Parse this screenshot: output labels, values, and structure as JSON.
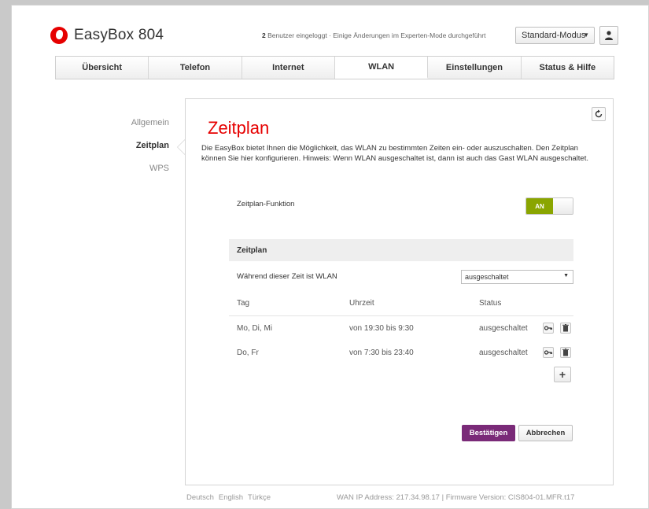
{
  "brand": {
    "name": "EasyBox 804"
  },
  "header": {
    "users_count": "2",
    "status_suffix": " Benutzer eingeloggt · Einige Änderungen im Experten-Mode durchgeführt",
    "mode": "Standard-Modus"
  },
  "nav": {
    "tabs": [
      "Übersicht",
      "Telefon",
      "Internet",
      "WLAN",
      "Einstellungen",
      "Status & Hilfe"
    ],
    "active": "WLAN"
  },
  "subnav": {
    "items": [
      "Allgemein",
      "Zeitplan",
      "WPS"
    ],
    "active": "Zeitplan"
  },
  "panel": {
    "title": "Zeitplan",
    "description": "Die EasyBox bietet Ihnen die Möglichkeit, das WLAN zu bestimmten Zeiten ein- oder auszuschalten. Den Zeitplan können Sie hier konfigurieren. Hinweis: Wenn WLAN ausgeschaltet ist, dann ist auch das Gast WLAN ausgeschaltet.",
    "function_label": "Zeitplan-Funktion",
    "toggle_label": "AN",
    "section_title": "Zeitplan",
    "while_label": "Während dieser Zeit ist WLAN",
    "while_value": "ausgeschaltet",
    "columns": [
      "Tag",
      "Uhrzeit",
      "Status"
    ],
    "rows": [
      {
        "tag": "Mo, Di, Mi",
        "uhrzeit": "von 19:30 bis 9:30",
        "status": "ausgeschaltet"
      },
      {
        "tag": "Do, Fr",
        "uhrzeit": "von 7:30 bis 23:40",
        "status": "ausgeschaltet"
      }
    ],
    "add_label": "+",
    "confirm_label": "Bestätigen",
    "cancel_label": "Abbrechen"
  },
  "footer": {
    "languages": [
      "Deutsch",
      "English",
      "Türkçe"
    ],
    "info": "WAN IP Address: 217.34.98.17 | Firmware Version: CIS804-01.MFR.t17"
  },
  "colors": {
    "accent_red": "#e60000",
    "toggle_on": "#8aa500",
    "confirm": "#7a2a78"
  }
}
